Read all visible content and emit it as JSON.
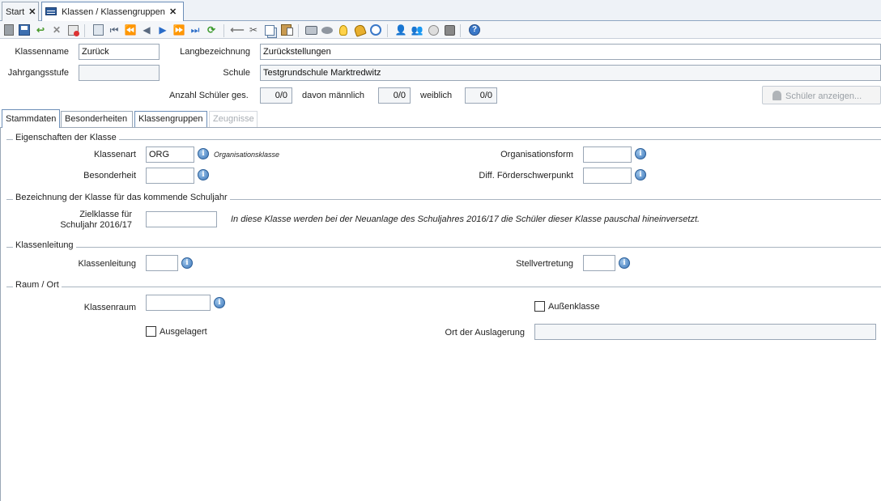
{
  "tabs": [
    {
      "label": "Start",
      "close": "✕"
    },
    {
      "label": "Klassen / Klassengruppen",
      "close": "✕"
    }
  ],
  "toolbar": {
    "icons": [
      "new-icon",
      "save-icon",
      "undo-icon",
      "delete-icon",
      "delete-list-icon",
      "copy-record-icon",
      "first-icon",
      "prev-page-icon",
      "prev-icon",
      "next-icon",
      "next-page-icon",
      "last-icon",
      "refresh-icon",
      "back-arrow-icon",
      "cut-icon",
      "copy-icon",
      "paste-icon",
      "print-icon",
      "preview-icon",
      "bulb-icon",
      "bell-icon",
      "clock-icon",
      "users-icon",
      "users-edit-icon",
      "users-settings-icon",
      "users-export-icon",
      "help-icon"
    ]
  },
  "header": {
    "klassenname_label": "Klassenname",
    "klassenname_value": "Zurück",
    "langbezeichnung_label": "Langbezeichnung",
    "langbezeichnung_value": "Zurückstellungen",
    "jahrgangsstufe_label": "Jahrgangsstufe",
    "jahrgangsstufe_value": "",
    "schule_label": "Schule",
    "schule_value": "Testgrundschule Marktredwitz",
    "anzahl_label": "Anzahl Schüler ges.",
    "anzahl_value": "0/0",
    "maennlich_label": "davon männlich",
    "maennlich_value": "0/0",
    "weiblich_label": "weiblich",
    "weiblich_value": "0/0",
    "schueler_button": "Schüler anzeigen..."
  },
  "inner_tabs": [
    "Stammdaten",
    "Besonderheiten",
    "Klassengruppen",
    "Zeugnisse"
  ],
  "eigenschaften": {
    "title": "Eigenschaften der Klasse",
    "klassenart_label": "Klassenart",
    "klassenart_value": "ORG",
    "klassenart_hint": "Organisationsklasse",
    "besonderheit_label": "Besonderheit",
    "besonderheit_value": "",
    "organisationsform_label": "Organisationsform",
    "organisationsform_value": "",
    "foerderschwerpunkt_label": "Diff. Förderschwerpunkt",
    "foerderschwerpunkt_value": ""
  },
  "kommend": {
    "title": "Bezeichnung der Klasse für das kommende Schuljahr",
    "zielklasse_label_1": "Zielklasse für",
    "zielklasse_label_2": "Schuljahr 2016/17",
    "zielklasse_value": "",
    "hint": "In diese Klasse werden bei der Neuanlage des Schuljahres 2016/17 die Schüler dieser Klasse pauschal hineinversetzt."
  },
  "leitung": {
    "title": "Klassenleitung",
    "klassenleitung_label": "Klassenleitung",
    "klassenleitung_value": "",
    "stellvertretung_label": "Stellvertretung",
    "stellvertretung_value": ""
  },
  "raum": {
    "title": "Raum / Ort",
    "klassenraum_label": "Klassenraum",
    "klassenraum_value": "",
    "aussenklasse_label": "Außenklasse",
    "ausgelagert_label": "Ausgelagert",
    "ort_label": "Ort der Auslagerung",
    "ort_value": ""
  }
}
